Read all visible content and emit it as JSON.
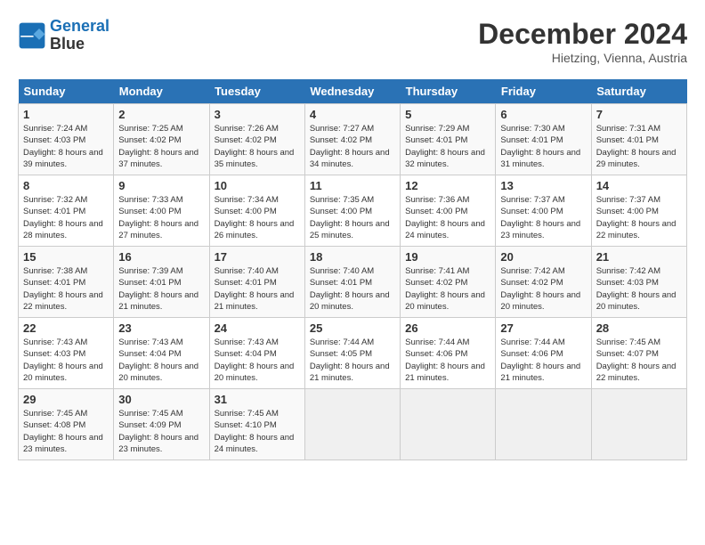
{
  "header": {
    "logo_line1": "General",
    "logo_line2": "Blue",
    "month": "December 2024",
    "location": "Hietzing, Vienna, Austria"
  },
  "weekdays": [
    "Sunday",
    "Monday",
    "Tuesday",
    "Wednesday",
    "Thursday",
    "Friday",
    "Saturday"
  ],
  "weeks": [
    [
      {
        "day": "1",
        "sunrise": "Sunrise: 7:24 AM",
        "sunset": "Sunset: 4:03 PM",
        "daylight": "Daylight: 8 hours and 39 minutes."
      },
      {
        "day": "2",
        "sunrise": "Sunrise: 7:25 AM",
        "sunset": "Sunset: 4:02 PM",
        "daylight": "Daylight: 8 hours and 37 minutes."
      },
      {
        "day": "3",
        "sunrise": "Sunrise: 7:26 AM",
        "sunset": "Sunset: 4:02 PM",
        "daylight": "Daylight: 8 hours and 35 minutes."
      },
      {
        "day": "4",
        "sunrise": "Sunrise: 7:27 AM",
        "sunset": "Sunset: 4:02 PM",
        "daylight": "Daylight: 8 hours and 34 minutes."
      },
      {
        "day": "5",
        "sunrise": "Sunrise: 7:29 AM",
        "sunset": "Sunset: 4:01 PM",
        "daylight": "Daylight: 8 hours and 32 minutes."
      },
      {
        "day": "6",
        "sunrise": "Sunrise: 7:30 AM",
        "sunset": "Sunset: 4:01 PM",
        "daylight": "Daylight: 8 hours and 31 minutes."
      },
      {
        "day": "7",
        "sunrise": "Sunrise: 7:31 AM",
        "sunset": "Sunset: 4:01 PM",
        "daylight": "Daylight: 8 hours and 29 minutes."
      }
    ],
    [
      {
        "day": "8",
        "sunrise": "Sunrise: 7:32 AM",
        "sunset": "Sunset: 4:01 PM",
        "daylight": "Daylight: 8 hours and 28 minutes."
      },
      {
        "day": "9",
        "sunrise": "Sunrise: 7:33 AM",
        "sunset": "Sunset: 4:00 PM",
        "daylight": "Daylight: 8 hours and 27 minutes."
      },
      {
        "day": "10",
        "sunrise": "Sunrise: 7:34 AM",
        "sunset": "Sunset: 4:00 PM",
        "daylight": "Daylight: 8 hours and 26 minutes."
      },
      {
        "day": "11",
        "sunrise": "Sunrise: 7:35 AM",
        "sunset": "Sunset: 4:00 PM",
        "daylight": "Daylight: 8 hours and 25 minutes."
      },
      {
        "day": "12",
        "sunrise": "Sunrise: 7:36 AM",
        "sunset": "Sunset: 4:00 PM",
        "daylight": "Daylight: 8 hours and 24 minutes."
      },
      {
        "day": "13",
        "sunrise": "Sunrise: 7:37 AM",
        "sunset": "Sunset: 4:00 PM",
        "daylight": "Daylight: 8 hours and 23 minutes."
      },
      {
        "day": "14",
        "sunrise": "Sunrise: 7:37 AM",
        "sunset": "Sunset: 4:00 PM",
        "daylight": "Daylight: 8 hours and 22 minutes."
      }
    ],
    [
      {
        "day": "15",
        "sunrise": "Sunrise: 7:38 AM",
        "sunset": "Sunset: 4:01 PM",
        "daylight": "Daylight: 8 hours and 22 minutes."
      },
      {
        "day": "16",
        "sunrise": "Sunrise: 7:39 AM",
        "sunset": "Sunset: 4:01 PM",
        "daylight": "Daylight: 8 hours and 21 minutes."
      },
      {
        "day": "17",
        "sunrise": "Sunrise: 7:40 AM",
        "sunset": "Sunset: 4:01 PM",
        "daylight": "Daylight: 8 hours and 21 minutes."
      },
      {
        "day": "18",
        "sunrise": "Sunrise: 7:40 AM",
        "sunset": "Sunset: 4:01 PM",
        "daylight": "Daylight: 8 hours and 20 minutes."
      },
      {
        "day": "19",
        "sunrise": "Sunrise: 7:41 AM",
        "sunset": "Sunset: 4:02 PM",
        "daylight": "Daylight: 8 hours and 20 minutes."
      },
      {
        "day": "20",
        "sunrise": "Sunrise: 7:42 AM",
        "sunset": "Sunset: 4:02 PM",
        "daylight": "Daylight: 8 hours and 20 minutes."
      },
      {
        "day": "21",
        "sunrise": "Sunrise: 7:42 AM",
        "sunset": "Sunset: 4:03 PM",
        "daylight": "Daylight: 8 hours and 20 minutes."
      }
    ],
    [
      {
        "day": "22",
        "sunrise": "Sunrise: 7:43 AM",
        "sunset": "Sunset: 4:03 PM",
        "daylight": "Daylight: 8 hours and 20 minutes."
      },
      {
        "day": "23",
        "sunrise": "Sunrise: 7:43 AM",
        "sunset": "Sunset: 4:04 PM",
        "daylight": "Daylight: 8 hours and 20 minutes."
      },
      {
        "day": "24",
        "sunrise": "Sunrise: 7:43 AM",
        "sunset": "Sunset: 4:04 PM",
        "daylight": "Daylight: 8 hours and 20 minutes."
      },
      {
        "day": "25",
        "sunrise": "Sunrise: 7:44 AM",
        "sunset": "Sunset: 4:05 PM",
        "daylight": "Daylight: 8 hours and 21 minutes."
      },
      {
        "day": "26",
        "sunrise": "Sunrise: 7:44 AM",
        "sunset": "Sunset: 4:06 PM",
        "daylight": "Daylight: 8 hours and 21 minutes."
      },
      {
        "day": "27",
        "sunrise": "Sunrise: 7:44 AM",
        "sunset": "Sunset: 4:06 PM",
        "daylight": "Daylight: 8 hours and 21 minutes."
      },
      {
        "day": "28",
        "sunrise": "Sunrise: 7:45 AM",
        "sunset": "Sunset: 4:07 PM",
        "daylight": "Daylight: 8 hours and 22 minutes."
      }
    ],
    [
      {
        "day": "29",
        "sunrise": "Sunrise: 7:45 AM",
        "sunset": "Sunset: 4:08 PM",
        "daylight": "Daylight: 8 hours and 23 minutes."
      },
      {
        "day": "30",
        "sunrise": "Sunrise: 7:45 AM",
        "sunset": "Sunset: 4:09 PM",
        "daylight": "Daylight: 8 hours and 23 minutes."
      },
      {
        "day": "31",
        "sunrise": "Sunrise: 7:45 AM",
        "sunset": "Sunset: 4:10 PM",
        "daylight": "Daylight: 8 hours and 24 minutes."
      },
      null,
      null,
      null,
      null
    ]
  ]
}
